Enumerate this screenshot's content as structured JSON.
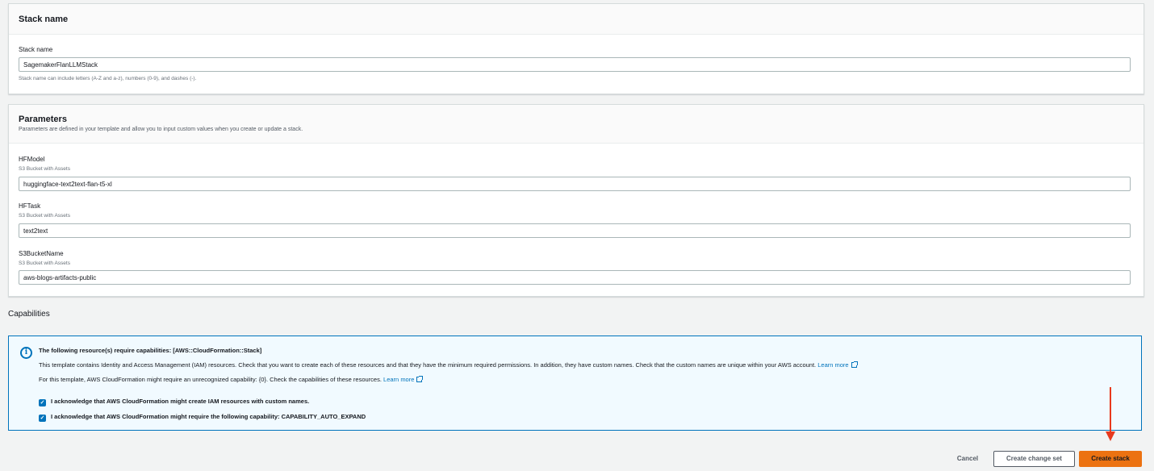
{
  "stack_name_panel": {
    "title": "Stack name",
    "field_label": "Stack name",
    "value": "SagemakerFlanLLMStack",
    "hint": "Stack name can include letters (A-Z and a-z), numbers (0-9), and dashes (-)."
  },
  "parameters_panel": {
    "title": "Parameters",
    "description": "Parameters are defined in your template and allow you to input custom values when you create or update a stack.",
    "fields": [
      {
        "label": "HFModel",
        "description": "S3 Bucket with Assets",
        "value": "huggingface-text2text-flan-t5-xl"
      },
      {
        "label": "HFTask",
        "description": "S3 Bucket with Assets",
        "value": "text2text"
      },
      {
        "label": "S3BucketName",
        "description": "S3 Bucket with Assets",
        "value": "aws-blogs-artifacts-public"
      }
    ]
  },
  "capabilities": {
    "heading": "Capabilities",
    "alert_title": "The following resource(s) require capabilities: [AWS::CloudFormation::Stack]",
    "line1": "This template contains Identity and Access Management (IAM) resources. Check that you want to create each of these resources and that they have the minimum required permissions. In addition, they have custom names. Check that the custom names are unique within your AWS account.",
    "line2": "For this template, AWS CloudFormation might require an unrecognized capability: {0}. Check the capabilities of these resources.",
    "learn_more": "Learn more",
    "ack1": "I acknowledge that AWS CloudFormation might create IAM resources with custom names.",
    "ack2": "I acknowledge that AWS CloudFormation might require the following capability: CAPABILITY_AUTO_EXPAND",
    "icon": "info-icon",
    "checked_state": [
      "checked",
      "checked"
    ]
  },
  "footer": {
    "cancel": "Cancel",
    "create_change_set": "Create change set",
    "create_stack": "Create stack"
  },
  "colors": {
    "primary_button": "#ec7211",
    "info_border": "#0073bb",
    "info_background": "#f1faff",
    "annotation_arrow": "#e8391d"
  }
}
